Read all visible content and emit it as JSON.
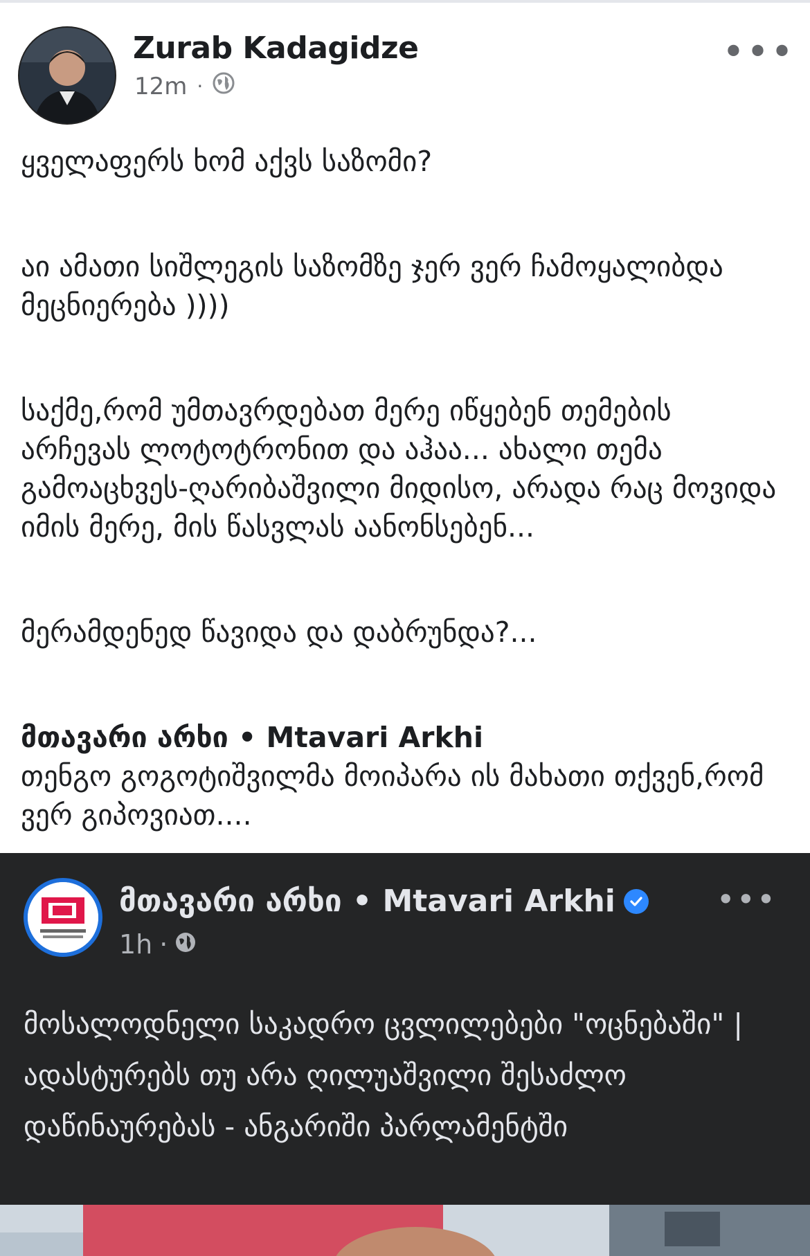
{
  "post": {
    "author": "Zurab Kadagidze",
    "time": "12m",
    "separator": "·",
    "more_label": "•••",
    "paragraphs": [
      "ყველაფერს  ხომ აქვს საზომი?",
      "აი ამათი სიშლეგის საზომზე ჯერ ვერ ჩამოყალიბდა მეცნიერება ))))",
      "საქმე,რომ უმთავრდებათ მერე იწყებენ თემების არჩევას ლოტოტრონით და აჰაა... ახალი თემა გამოაცხვეს-ღარიბაშვილი მიდისო, არადა რაც მოვიდა იმის მერე, მის წასვლას აანონსებენ...",
      "მერამდენედ წავიდა და დაბრუნდა?..."
    ],
    "shared_header": "მთავარი არხი • Mtavari Arkhi",
    "comment": "თენგო გოგოტიშვილმა მოიპარა ის მახათი თქვენ,რომ ვერ გიპოვიათ...."
  },
  "shared_card": {
    "page_name": "მთავარი არხი • Mtavari Arkhi",
    "time": "1h",
    "separator": "·",
    "more_label": "•••",
    "text": "მოსალოდნელი საკადრო ცვლილებები \"ოცნებაში\" | ადასტურებს თუ არა ღილუაშვილი შესაძლო დაწინაურებას - ანგარიში პარლამენტში"
  },
  "colors": {
    "card_background": "#242526",
    "verified_badge": "#2d88ff",
    "meta_text": "#65676b"
  }
}
